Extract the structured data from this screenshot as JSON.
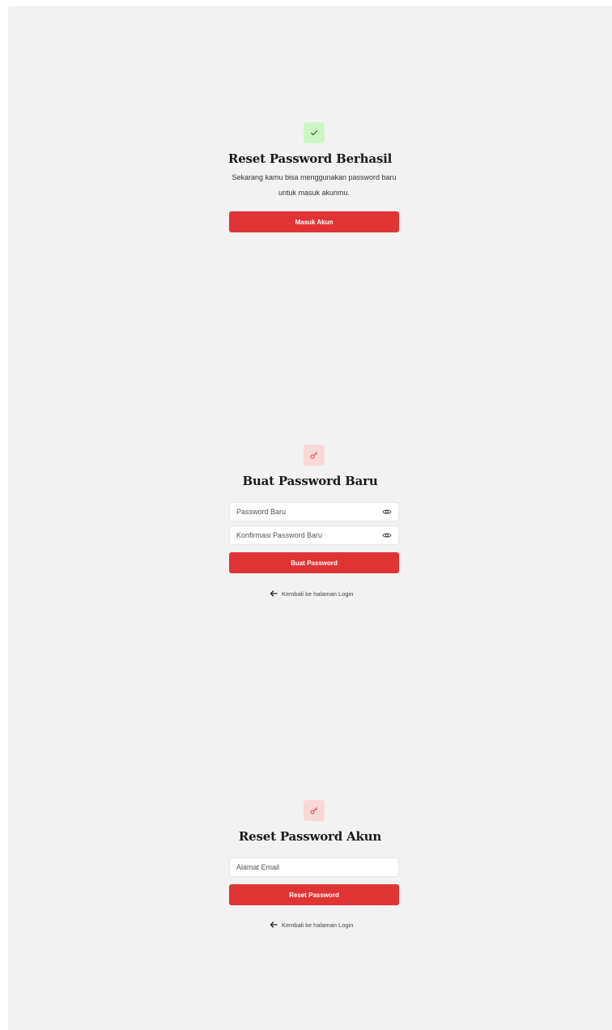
{
  "success_screen": {
    "title": "Reset Password Berhasil",
    "description": "Sekarang kamu bisa menggunakan password baru untuk masuk akunmu.",
    "button_label": "Masuk Akun",
    "icon": "check-icon"
  },
  "create_password_screen": {
    "title": "Buat Password Baru",
    "new_password_placeholder": "Password Baru",
    "confirm_password_placeholder": "Konfirmasi Password Baru",
    "button_label": "Buat Password",
    "back_link": "Kembali ke halaman Login",
    "icon": "key-icon"
  },
  "reset_screen": {
    "title": "Reset Password Akun",
    "email_placeholder": "Alamat Email",
    "button_label": "Reset Password",
    "back_link": "Kembali ke halaman Login",
    "icon": "key-icon"
  },
  "colors": {
    "background": "#f2f2f2",
    "primary": "#e03434",
    "success_bg": "#ccf7c4",
    "key_bg": "#fbd8d8"
  }
}
